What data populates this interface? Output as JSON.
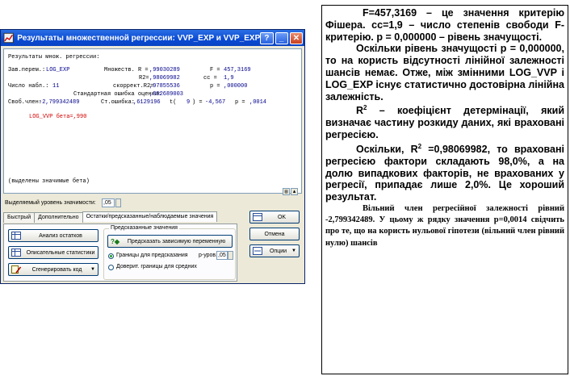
{
  "dialog": {
    "title": "Результаты множественной регрессии: VVP_EXP и VVP_EXP",
    "controls": {
      "help": "?",
      "minimize": "_",
      "close": "✕"
    },
    "results": {
      "heading": "Результаты множ. регрессии:",
      "dep_label": "Зав.перем.:",
      "dep_value": "LOG_EXP",
      "mult_r_label": "Множеств. R =",
      "mult_r_value": ",99030289",
      "f_label": "F =",
      "f_value": "457,3169",
      "r2_label": "R2=",
      "r2_value": ",98069982",
      "df_label": "cc =",
      "df_value": "1,9",
      "n_label": "Число набл.:",
      "n_value": "11",
      "adj_r2_label": "скоррект.R2=",
      "adj_r2_value": ",97855536",
      "p_label": "p =",
      "p_value": ",000000",
      "stderr_label": "Стандартная ошибка оценки:",
      "stderr_value": ",092689003",
      "intercept_label": "Своб.член:",
      "intercept_value": "-2,799342489",
      "intercept_se_label": "Ст.ошибка:",
      "intercept_se_value": ",6129196",
      "t_label": "t(",
      "t_df": "9",
      "t_eq": ") =",
      "t_value": "-4,567",
      "tp_label": "p =",
      "tp_value": ",0014",
      "beta_line": "LOG_VVP бета=,990",
      "footnote": "(выделены значимые бета)"
    },
    "alpha_label": "Выделяемый уровень значимости:",
    "alpha_value": ",05",
    "tabs": [
      {
        "label": "Быстрый"
      },
      {
        "label": "Дополнительно"
      },
      {
        "label": "Остатки/предсказанные/наблюдаемые значения"
      }
    ],
    "buttons": {
      "residual_analysis": "Анализ остатков",
      "descriptive_stats": "Описательные статистики",
      "generate_code": "Сгенерировать код",
      "ok": "OK",
      "cancel": "Отмена",
      "options": "Опции"
    },
    "predicted_group": {
      "legend": "Предсказанные значения",
      "predict_button": "Предсказать зависимую переменную",
      "radio_pred_limits": "Границы для предсказания",
      "p_level_label": "p-уров.",
      "p_level_value": ",05",
      "radio_conf_limits": "Доверит. границы для средних"
    }
  },
  "text": {
    "p1": "F=457,3169 – це значення критерію Фішера. cc=1,9 – число степенів свободи F- критерію. p = 0,000000 – рівень значущості.",
    "p2": "Оскільки рівень значущості p = 0,000000, то на користь відсутності лінійної залежності шансів немає. Отже, між змінними LOG_VVP і LOG_EXP існує статистично достовірна лінійна залежність.",
    "p3_r": "R",
    "p3_sup": "2",
    "p3": " – коефіцієнт детермінації, який визначає частину розкиду даних, які враховані регресією.",
    "p4_a": "Оскільки, R",
    "p4_sup": "2",
    "p4_b": " =0,98069982, то враховані регресією фактори складають 98,0%, а на долю випадкових факторів, не врахованих у регресії, припадає лише 2,0%. Це хороший результат.",
    "p5": "Вільний член регресійної залежності рівний -2,799342489. У цьому ж рядку значення p=0,0014 свідчить про те, що на користь нульової гіпотези (вільний член рівний нулю) шансів"
  }
}
